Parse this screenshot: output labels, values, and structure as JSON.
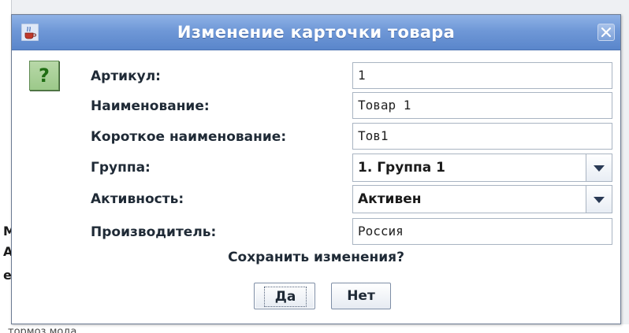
{
  "dialog": {
    "title": "Изменение карточки товара",
    "question": "Сохранить изменения?",
    "icons": {
      "title": "java-cup-icon",
      "close": "close-icon",
      "help": "question-mark-icon"
    },
    "help_glyph": "?",
    "fields": {
      "article": {
        "label": "Артикул:",
        "value": "1"
      },
      "name": {
        "label": "Наименование:",
        "value": "Товар 1"
      },
      "short_name": {
        "label": "Короткое наименование:",
        "value": "Тов1"
      },
      "group": {
        "label": "Группа:",
        "value": "1. Группа 1"
      },
      "activity": {
        "label": "Активность:",
        "value": "Активен"
      },
      "manufacturer": {
        "label": "Производитель:",
        "value": "Россия"
      }
    },
    "buttons": {
      "yes": "Да",
      "no": "Нет"
    }
  },
  "background": {
    "left_fragments": [
      "М",
      "А",
      "е"
    ],
    "bottom_text": "тормоз мода"
  },
  "colors": {
    "titlebar": "#6f98d7",
    "help_icon_bg": "#9cc98a",
    "help_glyph": "#1f6d13"
  }
}
